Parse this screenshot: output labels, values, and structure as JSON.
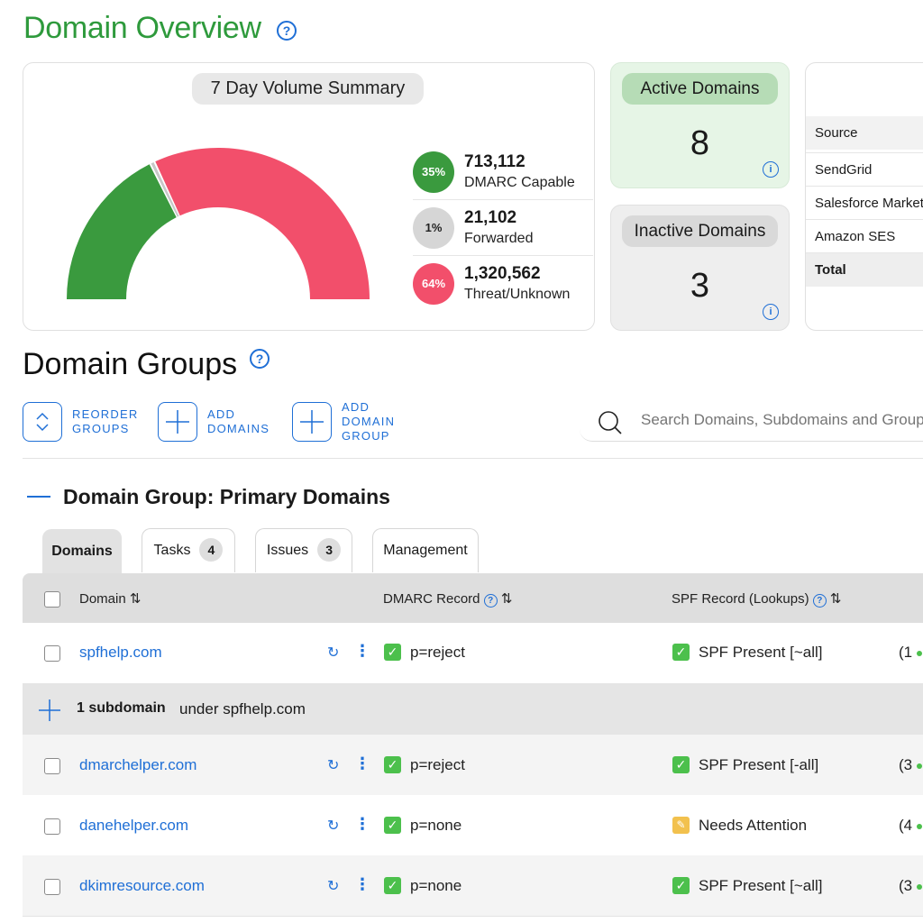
{
  "header": {
    "title": "Domain Overview"
  },
  "volume_summary": {
    "title": "7 Day Volume Summary",
    "chart_data": {
      "type": "pie",
      "categories": [
        "DMARC Capable",
        "Forwarded",
        "Threat/Unknown"
      ],
      "values": [
        35,
        1,
        64
      ],
      "colors": [
        "#3a9a3e",
        "#c8c8c8",
        "#f24f6b"
      ]
    },
    "items": [
      {
        "percent": "35%",
        "value": "713,112",
        "label": "DMARC Capable",
        "color": "#3a9a3e"
      },
      {
        "percent": "1%",
        "value": "21,102",
        "label": "Forwarded",
        "color": "#d6d6d6"
      },
      {
        "percent": "64%",
        "value": "1,320,562",
        "label": "Threat/Unknown",
        "color": "#f24f6b"
      }
    ]
  },
  "stats": {
    "active": {
      "label": "Active Domains",
      "count": "8"
    },
    "inactive": {
      "label": "Inactive Domains",
      "count": "3"
    }
  },
  "sources": {
    "header": "Source",
    "rows": [
      "SendGrid",
      "Salesforce Marketing",
      "Amazon SES"
    ],
    "total_label": "Total"
  },
  "domain_groups": {
    "title": "Domain Groups",
    "actions": {
      "reorder": [
        "REORDER",
        "GROUPS"
      ],
      "add_domains": [
        "ADD",
        "DOMAINS"
      ],
      "add_group": [
        "ADD",
        "DOMAIN",
        "GROUP"
      ]
    },
    "search_placeholder": "Search Domains, Subdomains and Groups",
    "group_heading": "Domain Group: Primary Domains",
    "tabs": [
      {
        "label": "Domains"
      },
      {
        "label": "Tasks",
        "count": "4"
      },
      {
        "label": "Issues",
        "count": "3"
      },
      {
        "label": "Management"
      }
    ],
    "columns": {
      "domain": "Domain",
      "dmarc": "DMARC Record",
      "spf": "SPF Record (Lookups)"
    },
    "subdomain_row": {
      "count_text": "1 subdomain",
      "under_text": "under spfhelp.com"
    },
    "rows": [
      {
        "domain": "spfhelp.com",
        "dmarc": "p=reject",
        "spf": "SPF Present [~all]",
        "spf_status": "ok",
        "lookups": "(1"
      },
      {
        "domain": "dmarchelper.com",
        "dmarc": "p=reject",
        "spf": "SPF Present [-all]",
        "spf_status": "ok",
        "lookups": "(3"
      },
      {
        "domain": "danehelper.com",
        "dmarc": "p=none",
        "spf": "Needs Attention",
        "spf_status": "warn",
        "lookups": "(4"
      },
      {
        "domain": "dkimresource.com",
        "dmarc": "p=none",
        "spf": "SPF Present [~all]",
        "spf_status": "ok",
        "lookups": "(3"
      }
    ]
  }
}
